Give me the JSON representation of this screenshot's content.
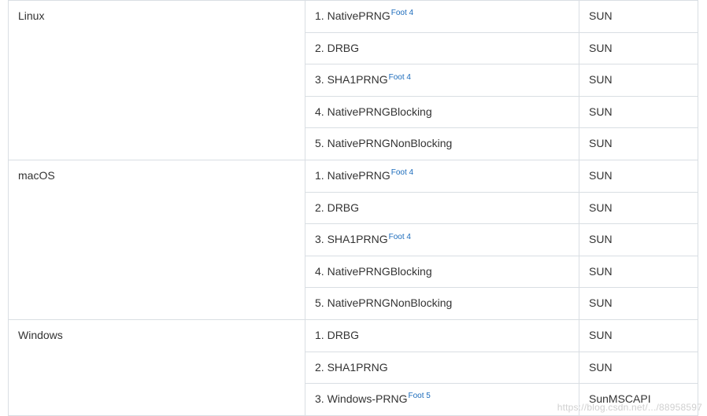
{
  "footnote_prefix": "Foot ",
  "table": {
    "groups": [
      {
        "os": "Linux",
        "rows": [
          {
            "n": "1",
            "algo": "NativePRNG",
            "foot": "4",
            "provider": "SUN"
          },
          {
            "n": "2",
            "algo": "DRBG",
            "foot": null,
            "provider": "SUN"
          },
          {
            "n": "3",
            "algo": "SHA1PRNG",
            "foot": "4",
            "provider": "SUN"
          },
          {
            "n": "4",
            "algo": "NativePRNGBlocking",
            "foot": null,
            "provider": "SUN"
          },
          {
            "n": "5",
            "algo": "NativePRNGNonBlocking",
            "foot": null,
            "provider": "SUN"
          }
        ]
      },
      {
        "os": "macOS",
        "rows": [
          {
            "n": "1",
            "algo": "NativePRNG",
            "foot": "4",
            "provider": "SUN"
          },
          {
            "n": "2",
            "algo": "DRBG",
            "foot": null,
            "provider": "SUN"
          },
          {
            "n": "3",
            "algo": "SHA1PRNG",
            "foot": "4",
            "provider": "SUN"
          },
          {
            "n": "4",
            "algo": "NativePRNGBlocking",
            "foot": null,
            "provider": "SUN"
          },
          {
            "n": "5",
            "algo": "NativePRNGNonBlocking",
            "foot": null,
            "provider": "SUN"
          }
        ]
      },
      {
        "os": "Windows",
        "rows": [
          {
            "n": "1",
            "algo": "DRBG",
            "foot": null,
            "provider": "SUN"
          },
          {
            "n": "2",
            "algo": "SHA1PRNG",
            "foot": null,
            "provider": "SUN"
          },
          {
            "n": "3",
            "algo": "Windows-PRNG",
            "foot": "5",
            "provider": "SunMSCAPI"
          }
        ]
      }
    ]
  },
  "watermark": "https://blog.csdn.net/.../88958597"
}
